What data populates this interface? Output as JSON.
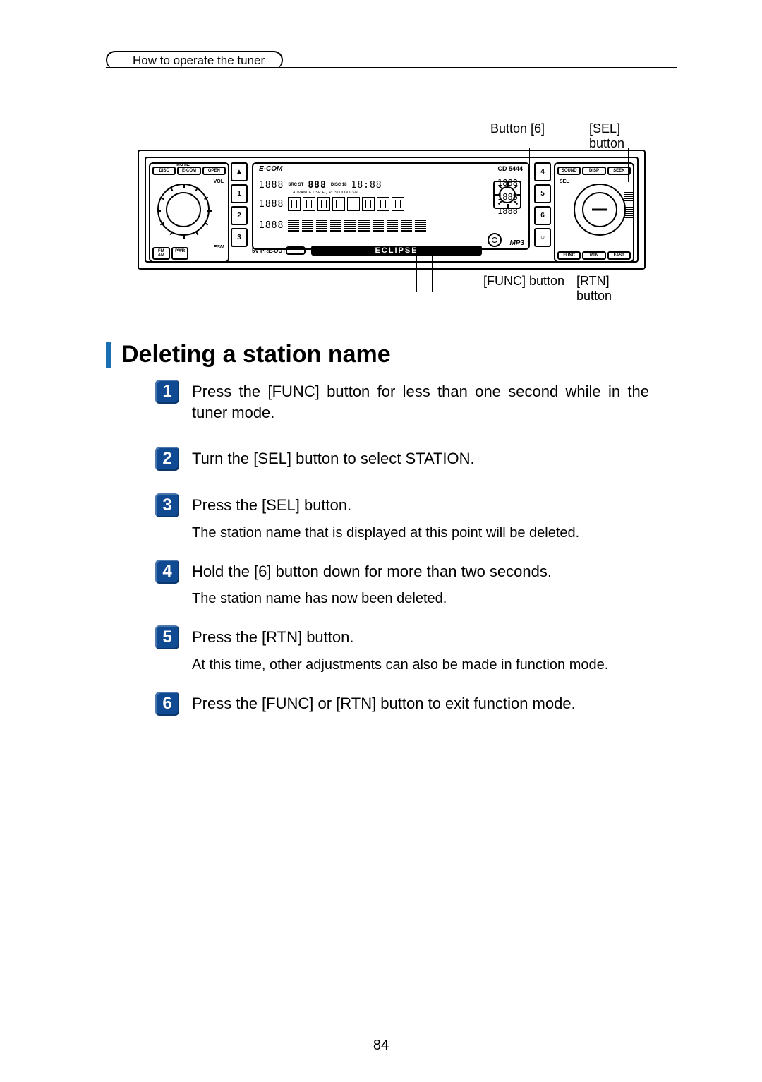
{
  "header": {
    "tab": "How to operate the tuner"
  },
  "figure": {
    "callouts": {
      "top_left": "Button [6]",
      "top_right": "[SEL] button",
      "bottom_left": "[FUNC] button",
      "bottom_right": "[RTN] button"
    },
    "left_block": {
      "mute": "MUTE",
      "buttons": [
        "DISC",
        "E-COM",
        "OPEN"
      ],
      "vol": "VOL",
      "esn": "ESN",
      "bottom": [
        "FM AM",
        "PWR"
      ]
    },
    "presets_left_eject": "▲",
    "presets_left": [
      "1",
      "2",
      "3"
    ],
    "lcd": {
      "ecom": "E-COM",
      "cd": "CD 5444",
      "row1_left": "1888",
      "row1_ind_top": "SRC ST",
      "row1_seg": "888",
      "row1_disc": "DISC 18",
      "row1_time": "18:88",
      "row1_tags": "ADVANCE  DSP  EQ  POSITION  CSNC",
      "row2_left": "1888",
      "row3_left": "1888",
      "right_col": [
        "1888",
        "1888",
        "1888"
      ],
      "mp3": "MP3"
    },
    "below_lcd": {
      "preout": "5V PRE-OUT",
      "brand": "ECLIPSE"
    },
    "presets_right": [
      "4",
      "5",
      "6",
      "○"
    ],
    "right_block": {
      "top": [
        "SOUND",
        "DISP",
        "SEEK"
      ],
      "sel": "SEL",
      "bottom": [
        "FUNC",
        "RTN",
        "FAST"
      ]
    }
  },
  "section": {
    "title": "Deleting a station name"
  },
  "steps": [
    {
      "n": "1",
      "instr": "Press the [FUNC] button for less than one second while in the tuner mode."
    },
    {
      "n": "2",
      "instr": "Turn the [SEL] button to select STATION."
    },
    {
      "n": "3",
      "instr": "Press the [SEL] button.",
      "note": "The station name that is displayed at this point will be deleted."
    },
    {
      "n": "4",
      "instr": "Hold the [6] button down for more than two seconds.",
      "note": "The station name has now been deleted."
    },
    {
      "n": "5",
      "instr": "Press the [RTN] button.",
      "note": "At this time, other adjustments can also be made in function mode."
    },
    {
      "n": "6",
      "instr": "Press the [FUNC] or [RTN] button to exit function mode."
    }
  ],
  "page_number": "84"
}
